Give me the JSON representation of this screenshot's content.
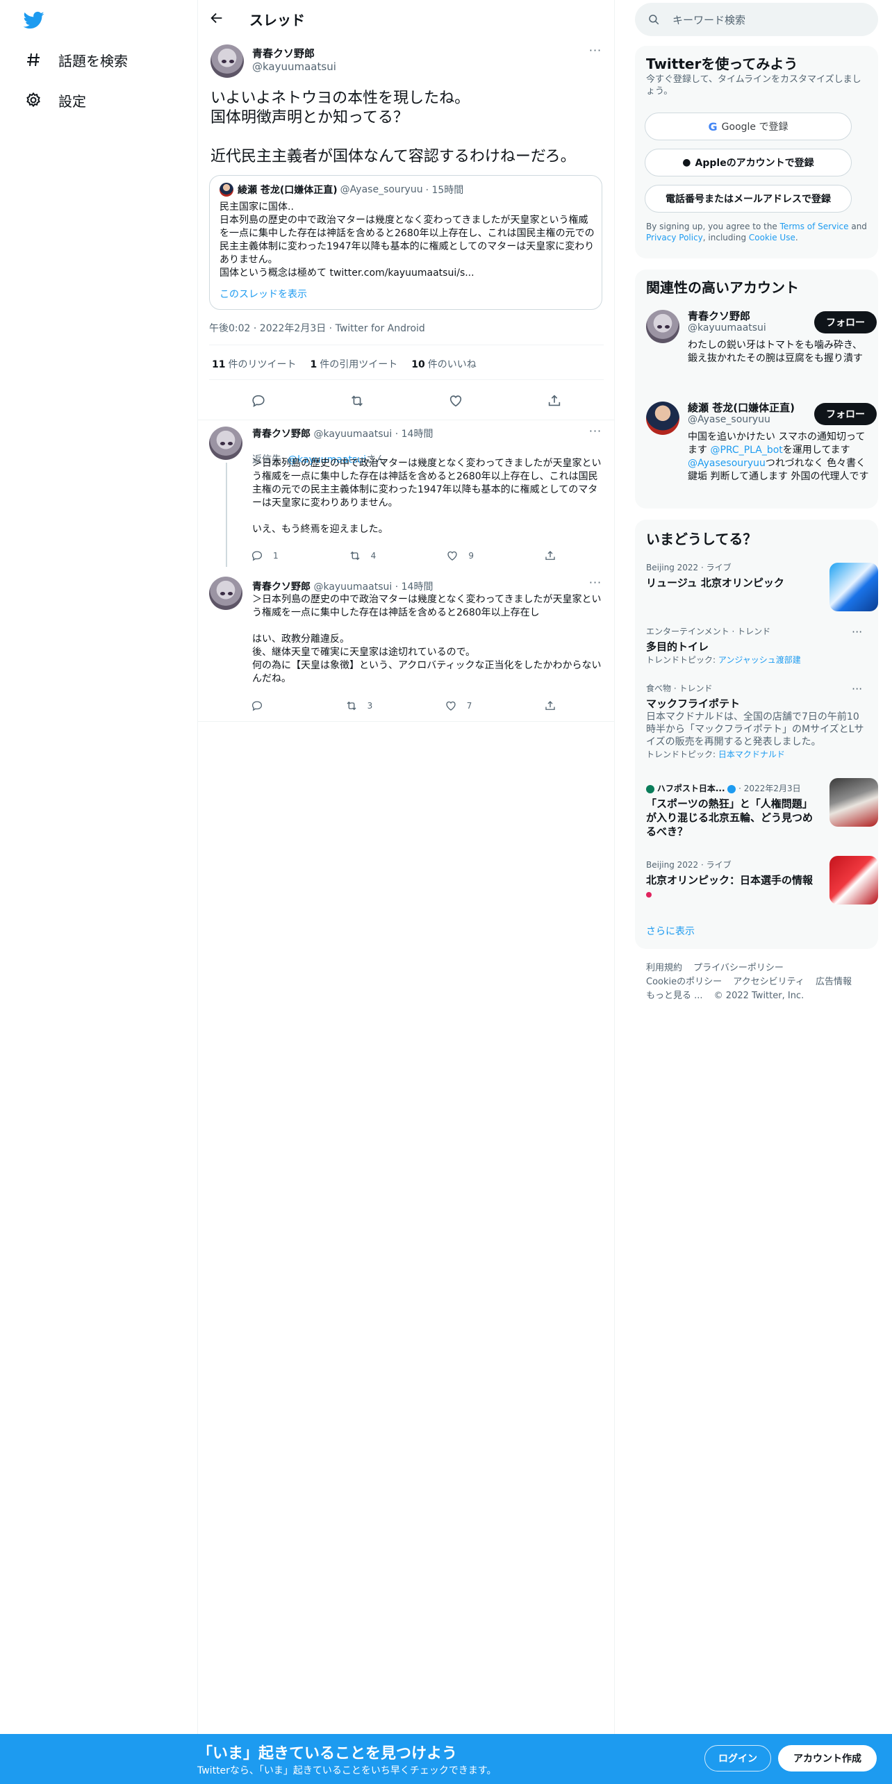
{
  "nav": {
    "items": [
      {
        "label": "話題を検索",
        "icon": "hashtag-icon"
      },
      {
        "label": "設定",
        "icon": "gear-icon"
      }
    ]
  },
  "header": {
    "title": "スレッド"
  },
  "tweet": {
    "name": "青春クソ野郎",
    "handle": "@kayuumaatsui",
    "text": "いよいよネトウヨの本性を現したね。\n国体明徴声明とか知ってる？\n\n近代民主主義者が国体なんて容認するわけねーだろ。",
    "quote": {
      "name": "綾瀬 苍龙(口嫌体正直)",
      "handle": "@Ayase_souryuu",
      "time": "· 15時間",
      "body": "民主国家に国体..\n日本列島の歴史の中で政治マターは幾度となく変わってきましたが天皇家という権威を一点に集中した存在は神話を含めると2680年以上存在し、これは国民主権の元での民主主義体制に変わった1947年以降も基本的に権威としてのマターは天皇家に変わりありません。\n国体という概念は極めて twitter.com/kayuumaatsui/s...",
      "show_thread": "このスレッドを表示"
    },
    "meta": "午後0:02 · 2022年2月3日 · Twitter for Android",
    "stats": {
      "retweets_count": "11",
      "retweets_label": "件のリツイート",
      "quotes_count": "1",
      "quotes_label": "件の引用ツイート",
      "likes_count": "10",
      "likes_label": "件のいいね"
    }
  },
  "replies": [
    {
      "name": "青春クソ野郎",
      "handle": "@kayuumaatsui",
      "time": "· 14時間",
      "reply_to_prefix": "返信先: ",
      "reply_to_handle": "@kayuumaatsui",
      "reply_to_suffix": "さん",
      "text": "＞日本列島の歴史の中で政治マターは幾度となく変わってきましたが天皇家という権威を一点に集中した存在は神話を含めると2680年以上存在し、これは国民主権の元での民主主義体制に変わった1947年以降も基本的に権威としてのマターは天皇家に変わりありません。\n\nいえ、もう終焉を迎えました。",
      "replies": "1",
      "retweets": "4",
      "likes": "9"
    },
    {
      "name": "青春クソ野郎",
      "handle": "@kayuumaatsui",
      "time": "· 14時間",
      "text": "＞日本列島の歴史の中で政治マターは幾度となく変わってきましたが天皇家という権威を一点に集中した存在は神話を含めると2680年以上存在し\n\nはい、政教分離違反。\n後、継体天皇で確実に天皇家は途切れているので。\n何の為に【天皇は象徴】という、アクロバティックな正当化をしたかわからないんだね。",
      "replies": "",
      "retweets": "3",
      "likes": "7"
    }
  ],
  "search": {
    "placeholder": "キーワード検索"
  },
  "signup": {
    "title": "Twitterを使ってみよう",
    "subtitle": "今すぐ登録して、タイムラインをカスタマイズしましょう。",
    "google": "Google で登録",
    "apple": "Appleのアカウントで登録",
    "phone": "電話番号またはメールアドレスで登録",
    "terms_pre": "By signing up, you agree to the ",
    "terms_tos": "Terms of Service",
    "terms_and": " and ",
    "terms_pp": "Privacy Policy",
    "terms_incl": ", including ",
    "terms_cookie": "Cookie Use",
    "terms_end": "."
  },
  "relevant": {
    "title": "関連性の高いアカウント",
    "accounts": [
      {
        "name": "青春クソ野郎",
        "handle": "@kayuumaatsui",
        "bio": "わたしの鋭い牙はトマトをも噛み砕き、鍛え抜かれたその腕は豆腐をも握り潰す",
        "follow": "フォロー"
      },
      {
        "name": "綾瀬 苍龙(口嫌体正直)",
        "handle": "@Ayase_souryuu",
        "bio_1": "中国を追いかけたい スマホの通知切ってます ",
        "bio_link1": "@PRC_PLA_bot",
        "bio_2": "を運用してます ",
        "bio_link2": "@Ayasesouryuu",
        "bio_3": "つれづれなく 色々書く鍵垢 判断して通します 外国の代理人です",
        "follow": "フォロー"
      }
    ]
  },
  "trends": {
    "title": "いまどうしてる？",
    "items": [
      {
        "sub": "Beijing 2022 · ライブ",
        "title": "リュージュ 北京オリンピック"
      },
      {
        "sub": "エンターテインメント · トレンド",
        "title": "多目的トイレ",
        "topic_label": "トレンドトピック: ",
        "topic": "アンジャッシュ渡部建"
      },
      {
        "sub": "食べ物 · トレンド",
        "title": "マックフライポテト",
        "desc": "日本マクドナルドは、全国の店舗で7日の午前10時半から「マックフライポテト」のMサイズとLサイズの販売を再開すると発表しました。",
        "topic_label": "トレンドトピック: ",
        "topic": "日本マクドナルド"
      },
      {
        "sub_source": "ハフポスト日本...",
        "sub_date": "· 2022年2月3日",
        "title": "「スポーツの熱狂」と「人権問題」が入り混じる北京五輪、どう見つめるべき？"
      },
      {
        "sub": "Beijing 2022 · ライブ",
        "title": "北京オリンピック：日本選手の情報"
      }
    ],
    "more": "さらに表示"
  },
  "footer": {
    "links": [
      "利用規約",
      "プライバシーポリシー",
      "Cookieのポリシー",
      "アクセシビリティ",
      "広告情報",
      "もっと見る ..."
    ],
    "copyright": "© 2022 Twitter, Inc."
  },
  "bottombar": {
    "title": "「いま」起きていることを見つけよう",
    "subtitle": "Twitterなら、「いま」起きていることをいち早くチェックできます。",
    "login": "ログイン",
    "create": "アカウント作成"
  },
  "colors": {
    "accent": "#1d9bf0",
    "text": "#0f1419",
    "muted": "#536471",
    "card": "#f7f9f9"
  }
}
